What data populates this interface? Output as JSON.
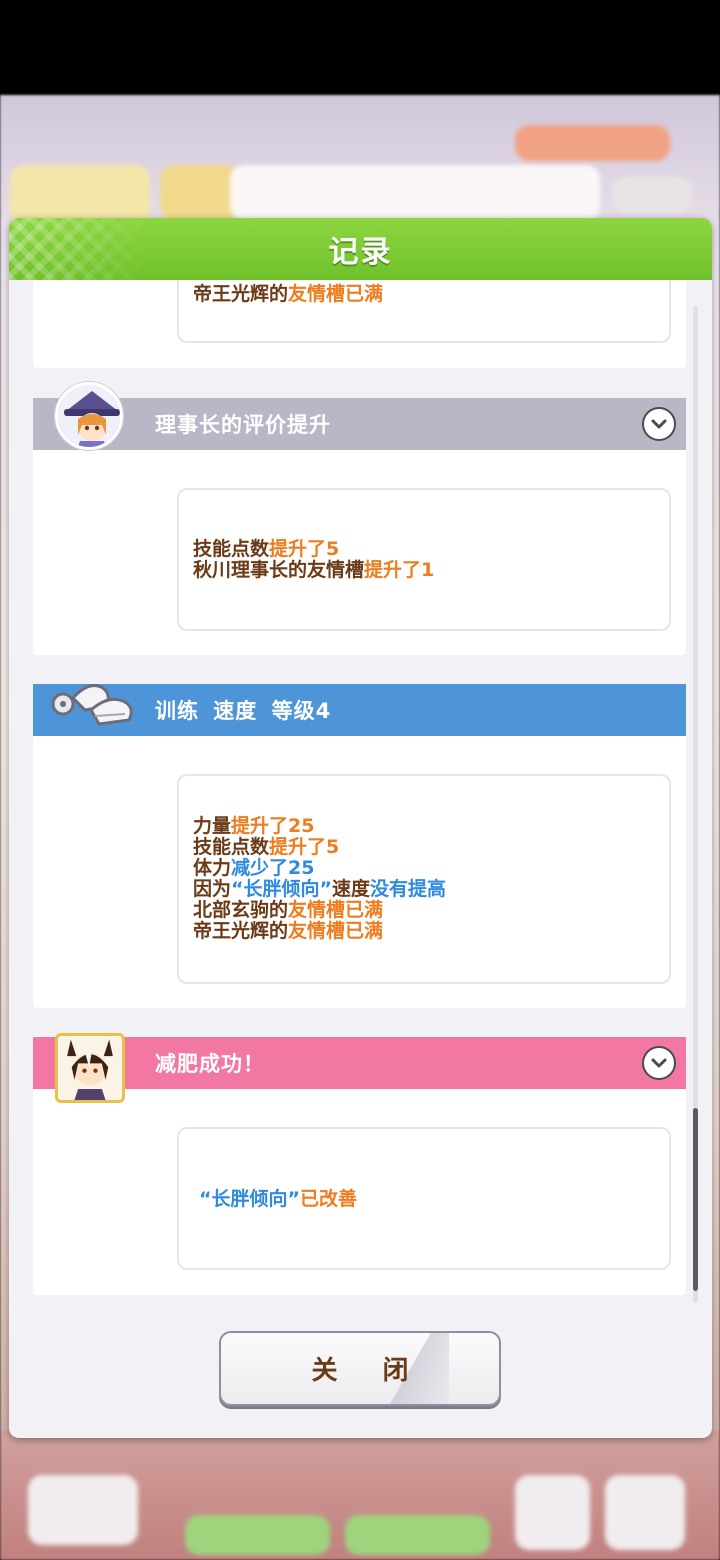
{
  "dialog": {
    "title": "记录",
    "close_label": "关 闭"
  },
  "entries": [
    {
      "id": "partial",
      "lines": [
        [
          {
            "t": "帝王光辉的",
            "c": "brown"
          },
          {
            "t": "友情槽已满",
            "c": "orange"
          }
        ]
      ]
    },
    {
      "id": "chairman",
      "title": "理事长的评价提升",
      "header_color": "#b9b6c6",
      "lines": [
        [
          {
            "t": "技能点数",
            "c": "brown"
          },
          {
            "t": "提升了5",
            "c": "orange"
          }
        ],
        [
          {
            "t": "秋川理事长的友情槽",
            "c": "brown"
          },
          {
            "t": "提升了1",
            "c": "orange"
          }
        ]
      ]
    },
    {
      "id": "training",
      "title": "训练 速度 等级4",
      "header_color": "#4d95d8",
      "lines": [
        [
          {
            "t": "力量",
            "c": "brown"
          },
          {
            "t": "提升了25",
            "c": "orange"
          }
        ],
        [
          {
            "t": "技能点数",
            "c": "brown"
          },
          {
            "t": "提升了5",
            "c": "orange"
          }
        ],
        [
          {
            "t": "体力",
            "c": "brown"
          },
          {
            "t": "减少了25",
            "c": "blue"
          }
        ],
        [
          {
            "t": "因为",
            "c": "brown"
          },
          {
            "t": "“长胖倾向”",
            "c": "blue"
          },
          {
            "t": "速度",
            "c": "brown"
          },
          {
            "t": "没有提高",
            "c": "blue"
          }
        ],
        [
          {
            "t": "北部玄驹的",
            "c": "brown"
          },
          {
            "t": "友情槽已满",
            "c": "orange"
          }
        ],
        [
          {
            "t": "帝王光辉的",
            "c": "brown"
          },
          {
            "t": "友情槽已满",
            "c": "orange"
          }
        ]
      ]
    },
    {
      "id": "diet",
      "title": "减肥成功！",
      "header_color": "#f277a3",
      "lines": [
        [
          {
            "t": "“长胖倾向”",
            "c": "blue"
          },
          {
            "t": "已改善",
            "c": "orange"
          }
        ]
      ]
    }
  ],
  "colors": {
    "header_green": "#7ccb33",
    "text_brown": "#6b3a17",
    "text_orange": "#ef7c1e",
    "text_blue": "#2f8ae0"
  }
}
